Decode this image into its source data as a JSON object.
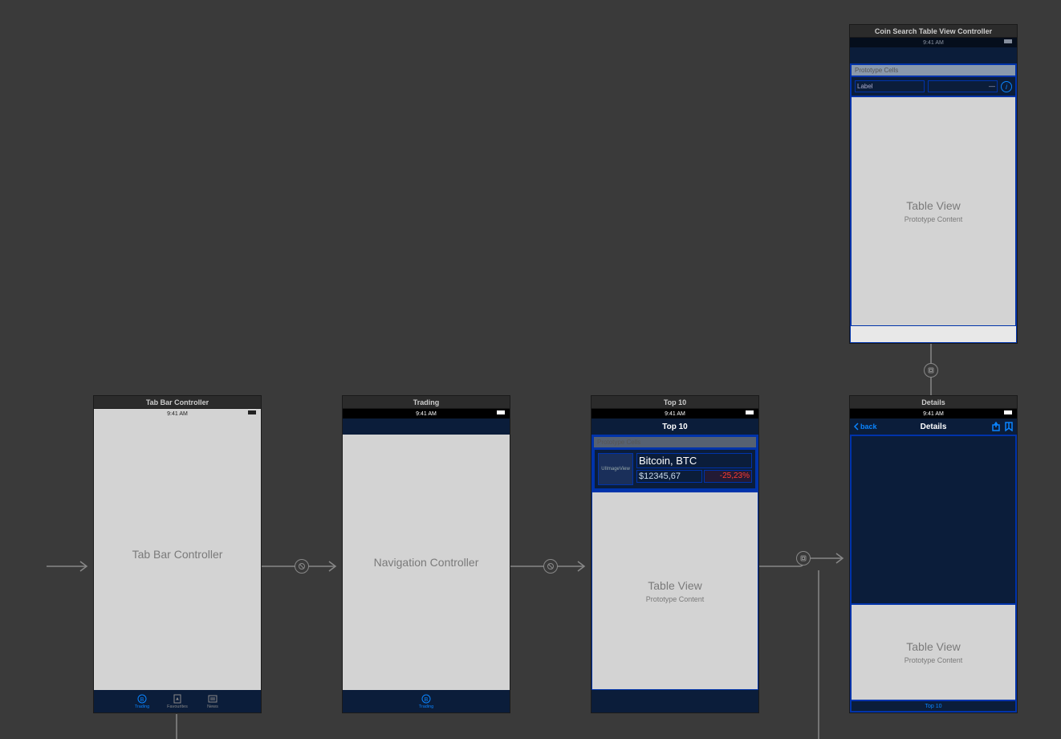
{
  "status_time": "9:41 AM",
  "tab_bar_controller": {
    "header": "Tab Bar Controller",
    "placeholder": "Tab Bar Controller",
    "tabs": [
      {
        "label": "Trading",
        "active": true
      },
      {
        "label": "Favourites",
        "active": false
      },
      {
        "label": "News",
        "active": false
      }
    ]
  },
  "navigation_controller": {
    "header": "Trading",
    "placeholder": "Navigation Controller",
    "tab": {
      "label": "Trading",
      "active": true
    }
  },
  "top10": {
    "header": "Top 10",
    "nav_title": "Top 10",
    "proto_header": "Prototype Cells",
    "cell": {
      "image_label": "UIImageView",
      "name": "Bitcoin, BTC",
      "price": "$12345,67",
      "pct": "-25,23%"
    },
    "table_title": "Table View",
    "table_sub": "Prototype Content"
  },
  "details": {
    "header": "Details",
    "nav_title": "Details",
    "back_label": "back",
    "table_title": "Table View",
    "table_sub": "Prototype Content",
    "tab_label": "Top 10"
  },
  "coin_search": {
    "header": "Coin Search Table View Controller",
    "proto_header": "Prototype Cells",
    "cell_label": "Label",
    "table_title": "Table View",
    "table_sub": "Prototype Content"
  }
}
